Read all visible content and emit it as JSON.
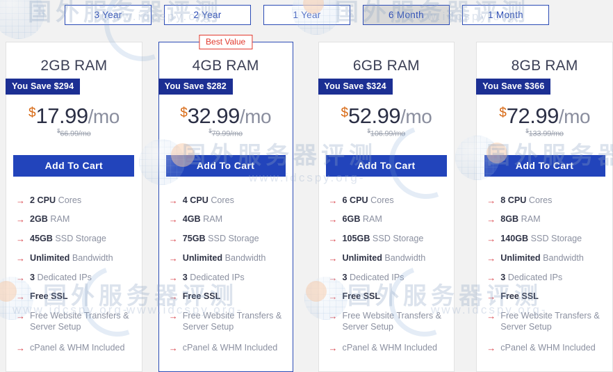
{
  "term_tabs": [
    {
      "label": "3 Year",
      "state": "normal"
    },
    {
      "label": "2 Year",
      "state": "normal"
    },
    {
      "label": "1 Year",
      "state": "normal"
    },
    {
      "label": "6 Month",
      "state": "hovered"
    },
    {
      "label": "1 Month",
      "state": "normal"
    }
  ],
  "colors": {
    "accent_blue": "#2244bb",
    "badge_navy": "#1c2f93",
    "best_value_red": "#e1392d",
    "arrow_red": "#d9434b",
    "currency_orange": "#d86a15",
    "page_bg": "#f2f2f2"
  },
  "badges": {
    "best_value": "Best Value"
  },
  "buttons": {
    "add_to_cart": "Add To Cart"
  },
  "plans": [
    {
      "title": "2GB RAM",
      "save_label": "You Save $294",
      "currency": "$",
      "price": "17.99",
      "period": "/mo",
      "old_price": "66.99/mo",
      "featured": false,
      "features": [
        {
          "strong": "2 CPU",
          "text": " Cores"
        },
        {
          "strong": "2GB",
          "text": " RAM"
        },
        {
          "strong": "45GB",
          "text": " SSD Storage"
        },
        {
          "strong": "Unlimited",
          "text": " Bandwidth"
        },
        {
          "strong": "3",
          "text": " Dedicated IPs"
        },
        {
          "strong": "Free SSL",
          "text": ""
        },
        {
          "strong": "",
          "text": "Free Website Transfers & Server Setup"
        },
        {
          "strong": "",
          "text": "cPanel & WHM Included"
        }
      ]
    },
    {
      "title": "4GB RAM",
      "save_label": "You Save $282",
      "currency": "$",
      "price": "32.99",
      "period": "/mo",
      "old_price": "79.99/mo",
      "featured": true,
      "features": [
        {
          "strong": "4 CPU",
          "text": " Cores"
        },
        {
          "strong": "4GB",
          "text": " RAM"
        },
        {
          "strong": "75GB",
          "text": " SSD Storage"
        },
        {
          "strong": "Unlimited",
          "text": " Bandwidth"
        },
        {
          "strong": "3",
          "text": " Dedicated IPs"
        },
        {
          "strong": "Free SSL",
          "text": ""
        },
        {
          "strong": "",
          "text": "Free Website Transfers & Server Setup"
        },
        {
          "strong": "",
          "text": "cPanel & WHM Included"
        }
      ]
    },
    {
      "title": "6GB RAM",
      "save_label": "You Save $324",
      "currency": "$",
      "price": "52.99",
      "period": "/mo",
      "old_price": "106.99/mo",
      "featured": false,
      "features": [
        {
          "strong": "6 CPU",
          "text": " Cores"
        },
        {
          "strong": "6GB",
          "text": " RAM"
        },
        {
          "strong": "105GB",
          "text": " SSD Storage"
        },
        {
          "strong": "Unlimited",
          "text": " Bandwidth"
        },
        {
          "strong": "3",
          "text": " Dedicated IPs"
        },
        {
          "strong": "Free SSL",
          "text": ""
        },
        {
          "strong": "",
          "text": "Free Website Transfers & Server Setup"
        },
        {
          "strong": "",
          "text": "cPanel & WHM Included"
        }
      ]
    },
    {
      "title": "8GB RAM",
      "save_label": "You Save $366",
      "currency": "$",
      "price": "72.99",
      "period": "/mo",
      "old_price": "133.99/mo",
      "featured": false,
      "features": [
        {
          "strong": "8 CPU",
          "text": " Cores"
        },
        {
          "strong": "8GB",
          "text": " RAM"
        },
        {
          "strong": "140GB",
          "text": " SSD Storage"
        },
        {
          "strong": "Unlimited",
          "text": " Bandwidth"
        },
        {
          "strong": "3",
          "text": " Dedicated IPs"
        },
        {
          "strong": "Free SSL",
          "text": ""
        },
        {
          "strong": "",
          "text": "Free Website Transfers & Server Setup"
        },
        {
          "strong": "",
          "text": "cPanel & WHM Included"
        }
      ]
    }
  ],
  "watermarks": {
    "site_text": "www.idcspy.org-",
    "brand_cn": "国外服务器评测"
  }
}
